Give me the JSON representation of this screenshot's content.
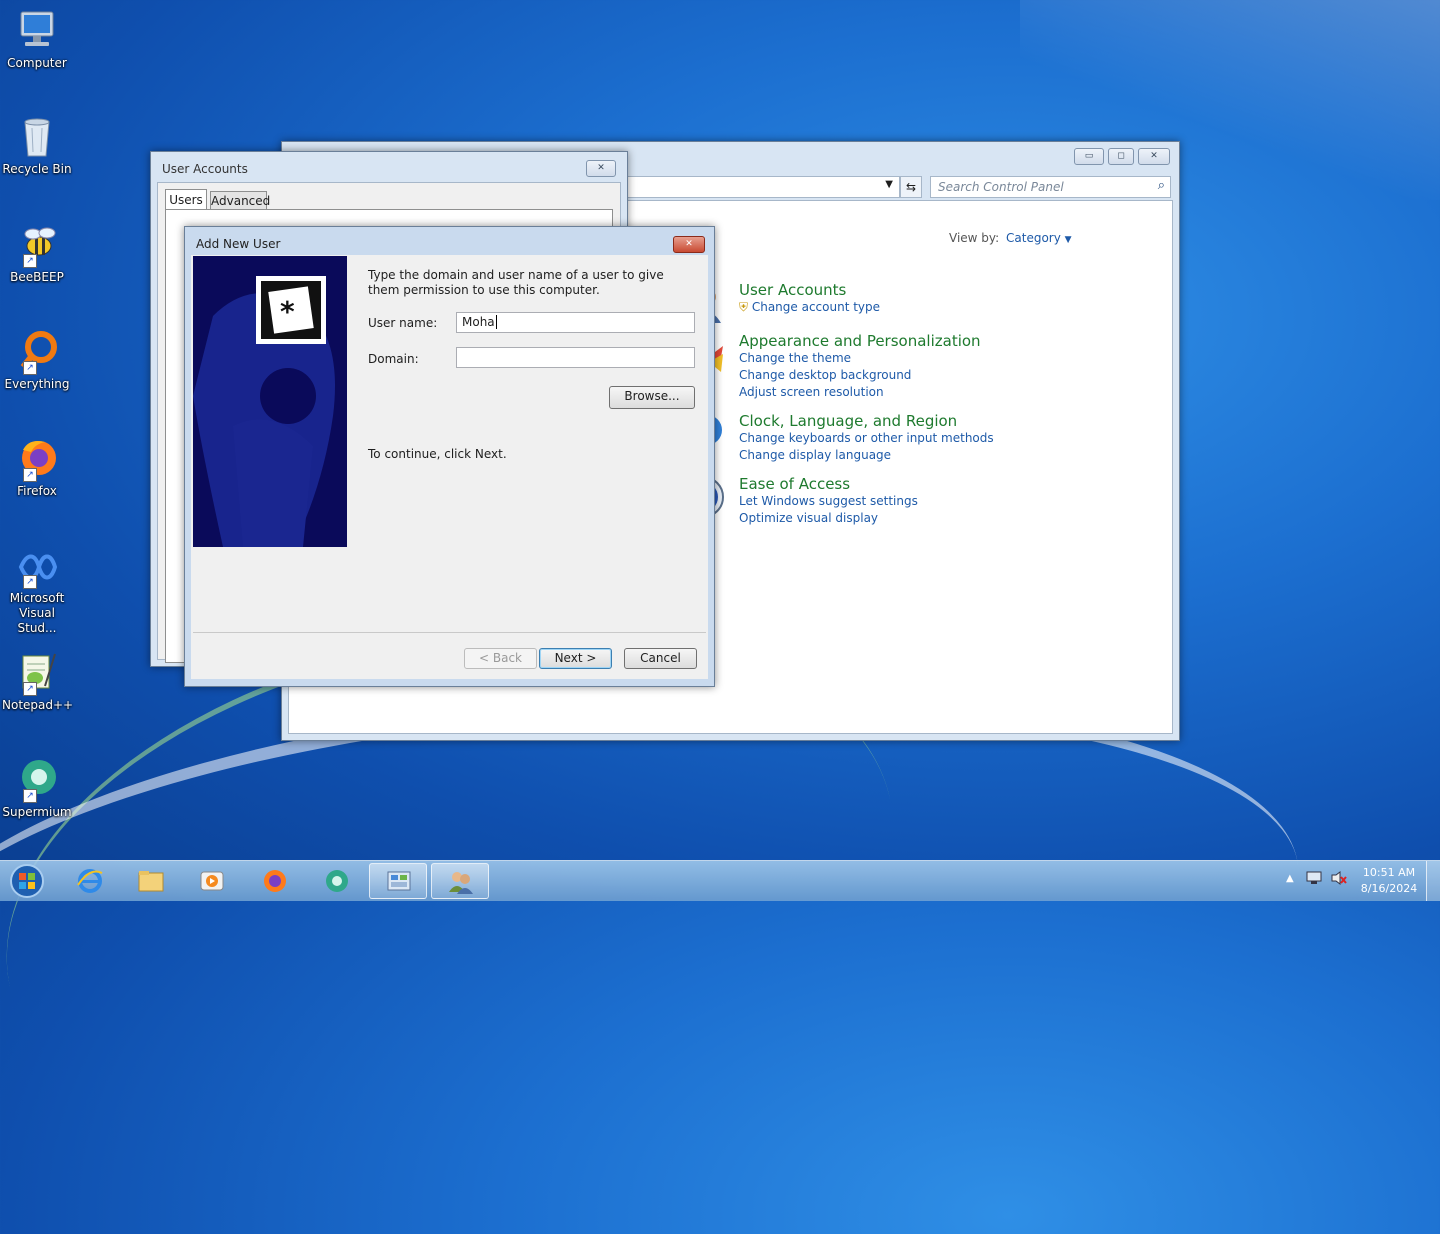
{
  "desktop": {
    "icons": [
      {
        "label": "Computer"
      },
      {
        "label": "Recycle Bin"
      },
      {
        "label": "BeeBEEP"
      },
      {
        "label": "Everything"
      },
      {
        "label": "Firefox"
      },
      {
        "label": "Microsoft Visual Stud..."
      },
      {
        "label": "Notepad++"
      },
      {
        "label": "Supermium"
      }
    ]
  },
  "control_panel": {
    "search_placeholder": "Search Control Panel",
    "view_by_label": "View by:",
    "view_by_value": "Category",
    "categories": [
      {
        "title": "User Accounts",
        "links": [
          "Change account type"
        ]
      },
      {
        "title": "Appearance and Personalization",
        "links": [
          "Change the theme",
          "Change desktop background",
          "Adjust screen resolution"
        ]
      },
      {
        "title": "Clock, Language, and Region",
        "links": [
          "Change keyboards or other input methods",
          "Change display language"
        ]
      },
      {
        "title": "Ease of Access",
        "links": [
          "Let Windows suggest settings",
          "Optimize visual display"
        ]
      }
    ]
  },
  "user_accounts": {
    "title": "User Accounts",
    "tabs": [
      "Users",
      "Advanced"
    ]
  },
  "add_user": {
    "title": "Add New User",
    "instructions": "Type the domain and user name of a user to give them permission to use this computer.",
    "username_label": "User name:",
    "username_value": "Moha",
    "domain_label": "Domain:",
    "domain_value": "",
    "browse": "Browse...",
    "continue_text": "To continue, click Next.",
    "back": "< Back",
    "next": "Next >",
    "cancel": "Cancel"
  },
  "taskbar": {
    "time": "10:51 AM",
    "date": "8/16/2024"
  },
  "colors": {
    "link": "#1e5aa8",
    "heading": "#1e7a2e",
    "wizard_panel": "#0a0a5a"
  }
}
